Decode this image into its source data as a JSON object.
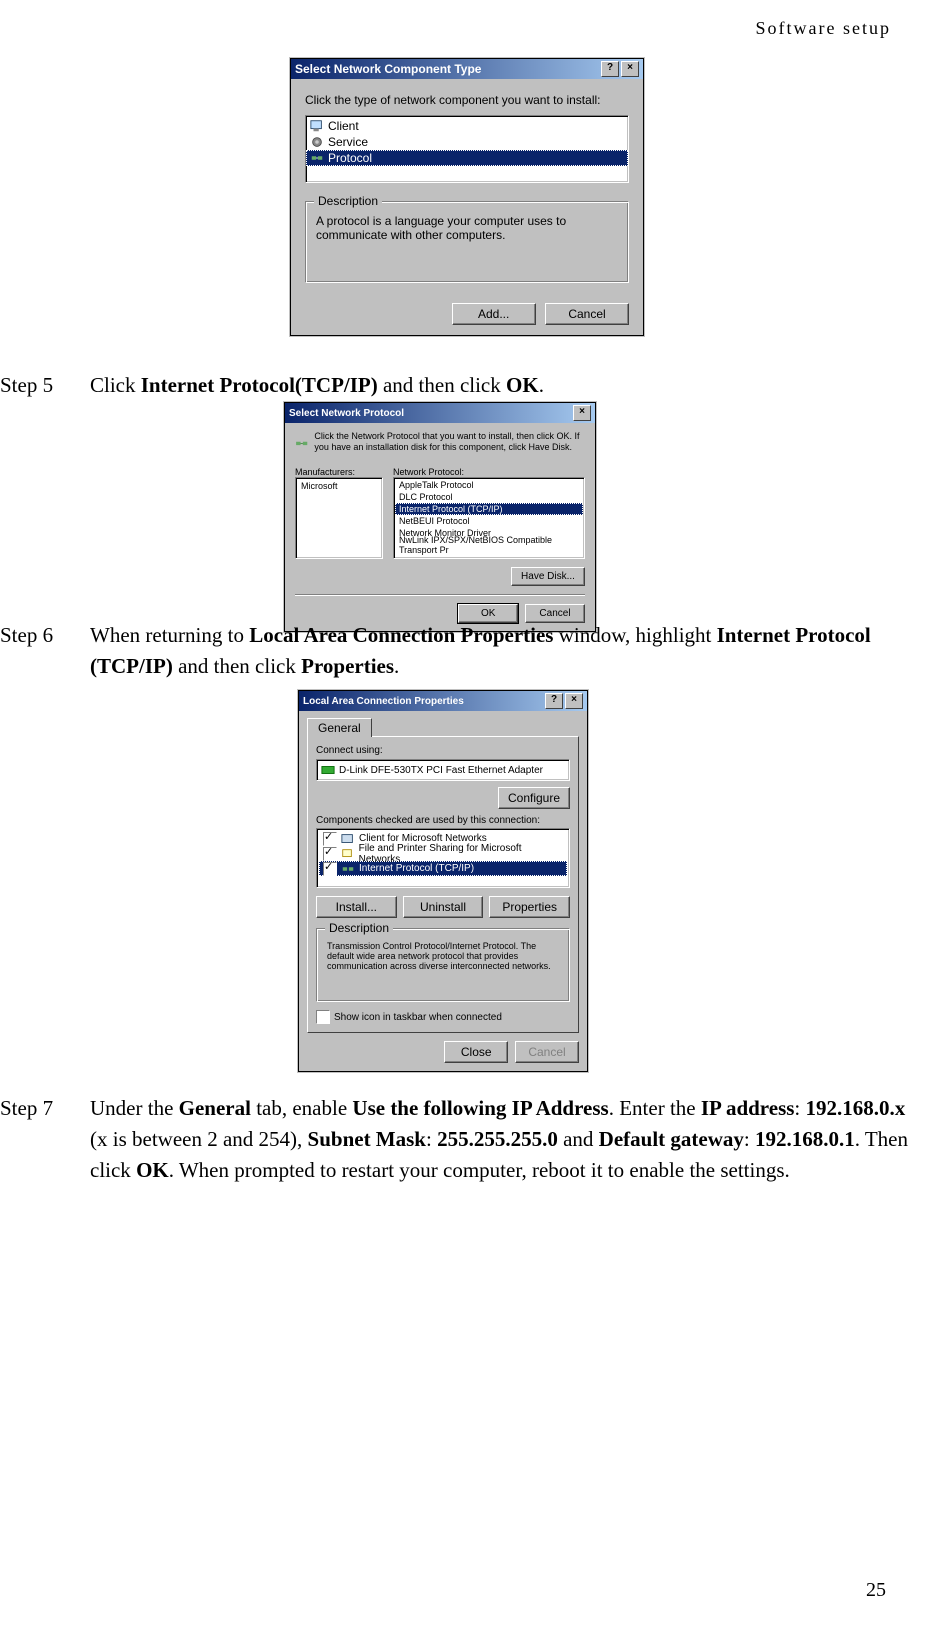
{
  "header": "Software  setup",
  "page_number": "25",
  "step5": {
    "label": "Step 5",
    "pre": "Click ",
    "bold1": "Internet Protocol(TCP/IP)",
    "mid": " and then click ",
    "bold2": "OK",
    "post": "."
  },
  "step6": {
    "label": "Step 6",
    "pre": "When returning to ",
    "bold1": "Local Area Connection Properties",
    "mid1": " window, highlight ",
    "bold2": "Internet Protocol (TCP/IP)",
    "mid2": " and then click ",
    "bold3": "Properties",
    "post": "."
  },
  "step7": {
    "label": "Step 7",
    "t1": "Under the ",
    "b1": "General",
    "t2": " tab, enable ",
    "b2": "Use the following IP Address",
    "t3": ". Enter the ",
    "b3": "IP address",
    "t4": ": ",
    "b4": "192.168.0.x",
    "t5": " (x is between 2 and 254), ",
    "b5": "Subnet Mask",
    "t6": ": ",
    "b6": "255.255.255.0",
    "t7": " and ",
    "b7": "Default gateway",
    "t8": ": ",
    "b8": "192.168.0.1",
    "t9": ". Then click ",
    "b9": "OK",
    "t10": ". When prompted to restart your computer, reboot it to enable the settings."
  },
  "dlg1": {
    "title": "Select Network Component Type",
    "help_btn": "?",
    "close_btn": "×",
    "prompt": "Click the type of network component you want to install:",
    "items": {
      "client": "Client",
      "service": "Service",
      "protocol": "Protocol"
    },
    "group_title": "Description",
    "description": "A protocol is a language your computer uses to communicate with other computers.",
    "add_btn": "Add...",
    "cancel_btn": "Cancel"
  },
  "dlg2": {
    "title": "Select Network Protocol",
    "close_btn": "×",
    "hint": "Click the Network Protocol that you want to install, then click OK. If you have an installation disk for this component, click Have Disk.",
    "manuf_label": "Manufacturers:",
    "proto_label": "Network Protocol:",
    "manufacturer": "Microsoft",
    "protocols": {
      "p0": "AppleTalk Protocol",
      "p1": "DLC Protocol",
      "p2": "Internet Protocol (TCP/IP)",
      "p3": "NetBEUI Protocol",
      "p4": "Network Monitor Driver",
      "p5": "NwLink IPX/SPX/NetBIOS Compatible Transport Pr"
    },
    "have_disk_btn": "Have Disk...",
    "ok_btn": "OK",
    "cancel_btn": "Cancel"
  },
  "dlg3": {
    "title": "Local Area Connection Properties",
    "help_btn": "?",
    "close_btn": "×",
    "tab": "General",
    "connect_label": "Connect using:",
    "adapter": "D-Link DFE-530TX PCI Fast Ethernet Adapter",
    "configure_btn": "Configure",
    "components_label": "Components checked are used by this connection:",
    "components": {
      "c0": "Client for Microsoft Networks",
      "c1": "File and Printer Sharing for Microsoft Networks",
      "c2": "Internet Protocol (TCP/IP)"
    },
    "install_btn": "Install...",
    "uninstall_btn": "Uninstall",
    "properties_btn": "Properties",
    "desc_legend": "Description",
    "desc_text": "Transmission Control Protocol/Internet Protocol. The default wide area network protocol that provides communication across diverse interconnected networks.",
    "show_icon": "Show icon in taskbar when connected",
    "close_btn2": "Close",
    "cancel_btn": "Cancel"
  }
}
